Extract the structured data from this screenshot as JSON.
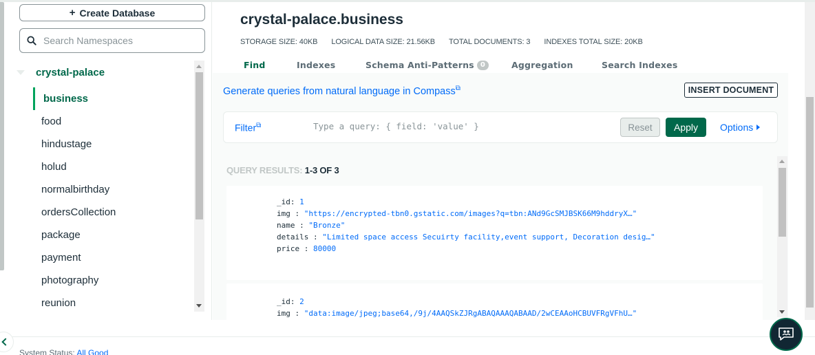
{
  "sidebar": {
    "create_db_label": "Create Database",
    "search_placeholder": "Search Namespaces",
    "database": "crystal-palace",
    "collections": [
      {
        "label": "business",
        "active": true
      },
      {
        "label": "food"
      },
      {
        "label": "hindustage"
      },
      {
        "label": "holud"
      },
      {
        "label": "normalbirthday"
      },
      {
        "label": "ordersCollection"
      },
      {
        "label": "package"
      },
      {
        "label": "payment"
      },
      {
        "label": "photography"
      },
      {
        "label": "reunion"
      }
    ]
  },
  "header": {
    "title": "crystal-palace.business",
    "stats": {
      "storage": "STORAGE SIZE: 40KB",
      "logical": "LOGICAL DATA SIZE: 21.56KB",
      "docs": "TOTAL DOCUMENTS: 3",
      "indexes": "INDEXES TOTAL SIZE: 20KB"
    }
  },
  "tabs": [
    {
      "label": "Find",
      "active": true
    },
    {
      "label": "Indexes"
    },
    {
      "label": "Schema Anti-Patterns",
      "badge": "0"
    },
    {
      "label": "Aggregation"
    },
    {
      "label": "Search Indexes"
    }
  ],
  "toolbar": {
    "nl_link": "Generate queries from natural language in Compass",
    "insert_label": "INSERT DOCUMENT"
  },
  "query": {
    "filter_label": "Filter",
    "placeholder": "Type a query: { field: 'value' }",
    "reset_label": "Reset",
    "apply_label": "Apply",
    "options_label": "Options"
  },
  "results": {
    "label": "QUERY RESULTS:",
    "count": "1-3 OF 3",
    "documents": [
      {
        "id": "1",
        "img": "\"https://encrypted-tbn0.gstatic.com/images?q=tbn:ANd9GcSMJBSK66M9hddryX…\"",
        "name": "\"Bronze\"",
        "details": "\"Limited space access Secuirty facility,event support, Decoration desig…\"",
        "price": "80000"
      },
      {
        "id": "2",
        "img": "\"data:image/jpeg;base64,/9j/4AAQSkZJRgABAQAAAQABAAD/2wCEAAoHCBUVFRgVFhU…\""
      }
    ]
  },
  "footer": {
    "system_status_label": "System Status:",
    "system_status_value": "All Good"
  },
  "colors": {
    "accent": "#00684a",
    "link": "#016bf8",
    "chat_bg": "#112733"
  }
}
